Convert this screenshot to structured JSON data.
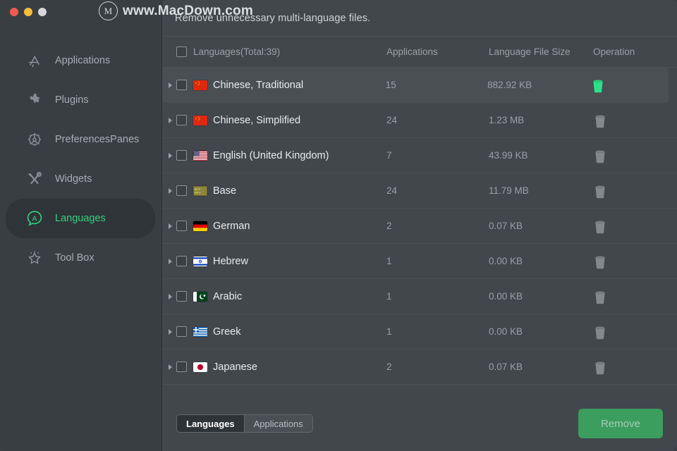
{
  "window": {
    "traffic_lights": [
      "close",
      "minimize",
      "maximize"
    ]
  },
  "sidebar": {
    "items": [
      {
        "label": "Applications",
        "icon": "appstore-icon",
        "active": false
      },
      {
        "label": "Plugins",
        "icon": "puzzle-piece-icon",
        "active": false
      },
      {
        "label": "PreferencesPanes",
        "icon": "gear-icon",
        "active": false
      },
      {
        "label": "Widgets",
        "icon": "tools-icon",
        "active": false
      },
      {
        "label": "Languages",
        "icon": "speech-bubble-a-icon",
        "active": true
      },
      {
        "label": "Tool Box",
        "icon": "star-icon",
        "active": false
      }
    ],
    "active_color": "#35d07f"
  },
  "topbar": {
    "title": "Remove unnecessary multi-language files.",
    "watermark": "www.MacDown.com",
    "watermark_logo": "M"
  },
  "table": {
    "headers": {
      "name": "Languages(Total:39)",
      "applications": "Applications",
      "size": "Language File Size",
      "operation": "Operation"
    },
    "rows": [
      {
        "name": "Chinese, Traditional",
        "flag": "flag-china",
        "applications": "15",
        "size": "882.92 KB",
        "trash": "trash-icon-active",
        "hover": true
      },
      {
        "name": "Chinese, Simplified",
        "flag": "flag-china",
        "applications": "24",
        "size": "1.23 MB",
        "trash": "trash-icon",
        "hover": false
      },
      {
        "name": "English (United Kingdom)",
        "flag": "flag-usa",
        "applications": "7",
        "size": "43.99 KB",
        "trash": "trash-icon",
        "hover": false
      },
      {
        "name": "Base",
        "flag": "flag-base",
        "applications": "24",
        "size": "11.79 MB",
        "trash": "trash-icon",
        "hover": false
      },
      {
        "name": "German",
        "flag": "flag-germany",
        "applications": "2",
        "size": "0.07 KB",
        "trash": "trash-icon",
        "hover": false
      },
      {
        "name": "Hebrew",
        "flag": "flag-israel",
        "applications": "1",
        "size": "0.00 KB",
        "trash": "trash-icon",
        "hover": false
      },
      {
        "name": "Arabic",
        "flag": "flag-arabic",
        "applications": "1",
        "size": "0.00 KB",
        "trash": "trash-icon",
        "hover": false
      },
      {
        "name": "Greek",
        "flag": "flag-greece",
        "applications": "1",
        "size": "0.00 KB",
        "trash": "trash-icon",
        "hover": false
      },
      {
        "name": "Japanese",
        "flag": "flag-japan",
        "applications": "2",
        "size": "0.07 KB",
        "trash": "trash-icon",
        "hover": false
      }
    ]
  },
  "bottom": {
    "segments": [
      {
        "label": "Languages",
        "selected": true
      },
      {
        "label": "Applications",
        "selected": false
      }
    ],
    "remove_label": "Remove",
    "remove_color": "#3b9d5e"
  }
}
